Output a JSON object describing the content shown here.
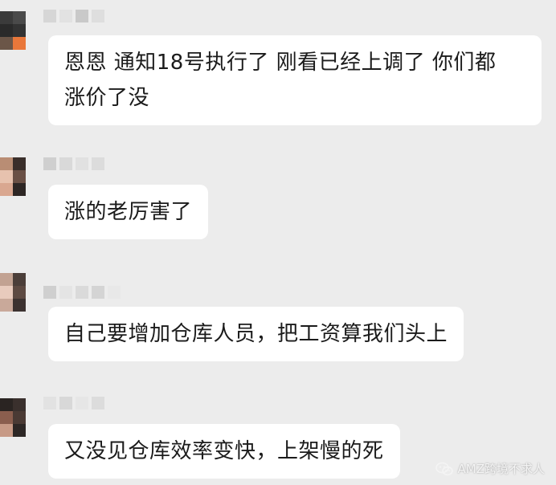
{
  "messages": [
    {
      "lines": [
        "恩恩 通知18号执行了 刚看已经上调了 你们都",
        "涨价了没"
      ]
    },
    {
      "lines": [
        "涨的老厉害了"
      ]
    },
    {
      "lines": [
        "自己要增加仓库人员，把工资算我们头上"
      ]
    },
    {
      "lines": [
        "又没见仓库效率变快，上架慢的死"
      ]
    }
  ],
  "watermark": {
    "text": "AMZ跨境不求人",
    "icon": "wechat-icon"
  },
  "colors": {
    "background": "#ececec",
    "bubble": "#ffffff",
    "text": "#1b1b1b"
  }
}
